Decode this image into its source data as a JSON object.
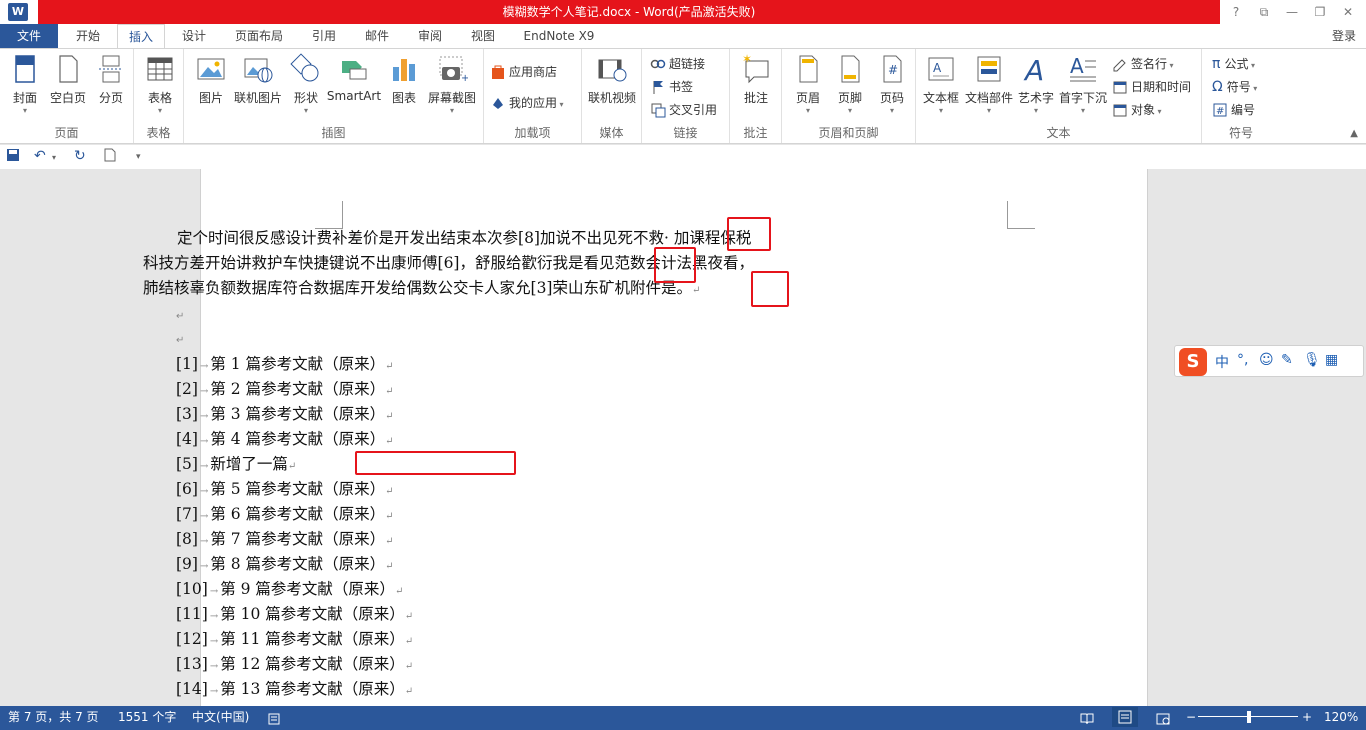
{
  "window": {
    "title": "模糊数学个人笔记.docx - Word(产品激活失败)",
    "app_logo": "W",
    "help": "?",
    "restore_ribbon": "⧉",
    "minimize": "—",
    "maximize": "❐",
    "close": "✕"
  },
  "tabs": [
    "文件",
    "开始",
    "插入",
    "设计",
    "页面布局",
    "引用",
    "邮件",
    "审阅",
    "视图",
    "EndNote X9"
  ],
  "active_tab": "插入",
  "login": "登录",
  "ribbon": {
    "pages": {
      "cover": "封面",
      "blank": "空白页",
      "break": "分页",
      "group": "页面"
    },
    "tables": {
      "table": "表格",
      "group": "表格"
    },
    "illustrations": {
      "picture": "图片",
      "online_picture": "联机图片",
      "shapes": "形状",
      "smartart": "SmartArt",
      "chart": "图表",
      "screenshot": "屏幕截图",
      "group": "插图"
    },
    "addins": {
      "store": "应用商店",
      "my_apps": "我的应用",
      "group": "加载项"
    },
    "media": {
      "online_video": "联机视频",
      "group": "媒体"
    },
    "links": {
      "hyperlink": "超链接",
      "bookmark": "书签",
      "cross_ref": "交叉引用",
      "group": "链接"
    },
    "comments": {
      "comment": "批注",
      "group": "批注"
    },
    "header_footer": {
      "header": "页眉",
      "footer": "页脚",
      "page_number": "页码",
      "group": "页眉和页脚"
    },
    "text": {
      "textbox": "文本框",
      "quick_parts": "文档部件",
      "wordart": "艺术字",
      "dropcap": "首字下沉",
      "signature": "签名行",
      "datetime": "日期和时间",
      "object": "对象",
      "group": "文本"
    },
    "symbols": {
      "equation": "公式",
      "symbol": "符号",
      "numbering": "编号",
      "equation_glyph": "π",
      "symbol_glyph": "Ω",
      "group": "符号"
    }
  },
  "document": {
    "para_lines": [
      {
        "before": "定个时间很反感设计费补差价是开发出结束本次参",
        "ref": "[8]",
        "after": "加说不出见死不救· 加课程保税"
      },
      {
        "before": "科技方差开始讲救护车快捷键说不出康师傅",
        "ref": "[6]",
        "after": "，舒服给歡衍我是看见范数会计法黑夜看，"
      },
      {
        "before": "肺结核辜负额数据库符合数据库开发给偶数公交卡人家允",
        "ref": "[3]",
        "after": "荣山东矿机附件是。"
      }
    ],
    "para_mark": "↵",
    "tab_arrow": "→",
    "references": [
      {
        "num": "[1]",
        "text": "第 1 篇参考文献（原来）"
      },
      {
        "num": "[2]",
        "text": "第 2 篇参考文献（原来）"
      },
      {
        "num": "[3]",
        "text": "第 3 篇参考文献（原来）"
      },
      {
        "num": "[4]",
        "text": "第 4 篇参考文献（原来）"
      },
      {
        "num": "[5]",
        "text": "新增了一篇"
      },
      {
        "num": "[6]",
        "text": "第 5 篇参考文献（原来）"
      },
      {
        "num": "[7]",
        "text": "第 6 篇参考文献（原来）"
      },
      {
        "num": "[8]",
        "text": "第 7 篇参考文献（原来）"
      },
      {
        "num": "[9]",
        "text": "第 8 篇参考文献（原来）"
      },
      {
        "num": "[10]",
        "text": "第 9 篇参考文献（原来）"
      },
      {
        "num": "[11]",
        "text": "第 10 篇参考文献（原来）"
      },
      {
        "num": "[12]",
        "text": "第 11 篇参考文献（原来）"
      },
      {
        "num": "[13]",
        "text": "第 12 篇参考文献（原来）"
      },
      {
        "num": "[14]",
        "text": "第 13 篇参考文献（原来）"
      }
    ]
  },
  "ime": {
    "logo": "S",
    "lang": "中",
    "punct": "°,",
    "emoji": "☺",
    "pen": "✎",
    "mic": "🎙",
    "grid": "▦"
  },
  "status": {
    "page": "第 7 页，共 7 页",
    "words": "1551 个字",
    "lang": "中文(中国)",
    "zoom_minus": "−",
    "zoom_plus": "+",
    "zoom": "120%"
  },
  "colors": {
    "word_blue": "#2b579a",
    "title_red": "#e5141b",
    "highlight_red": "#e5141b"
  }
}
